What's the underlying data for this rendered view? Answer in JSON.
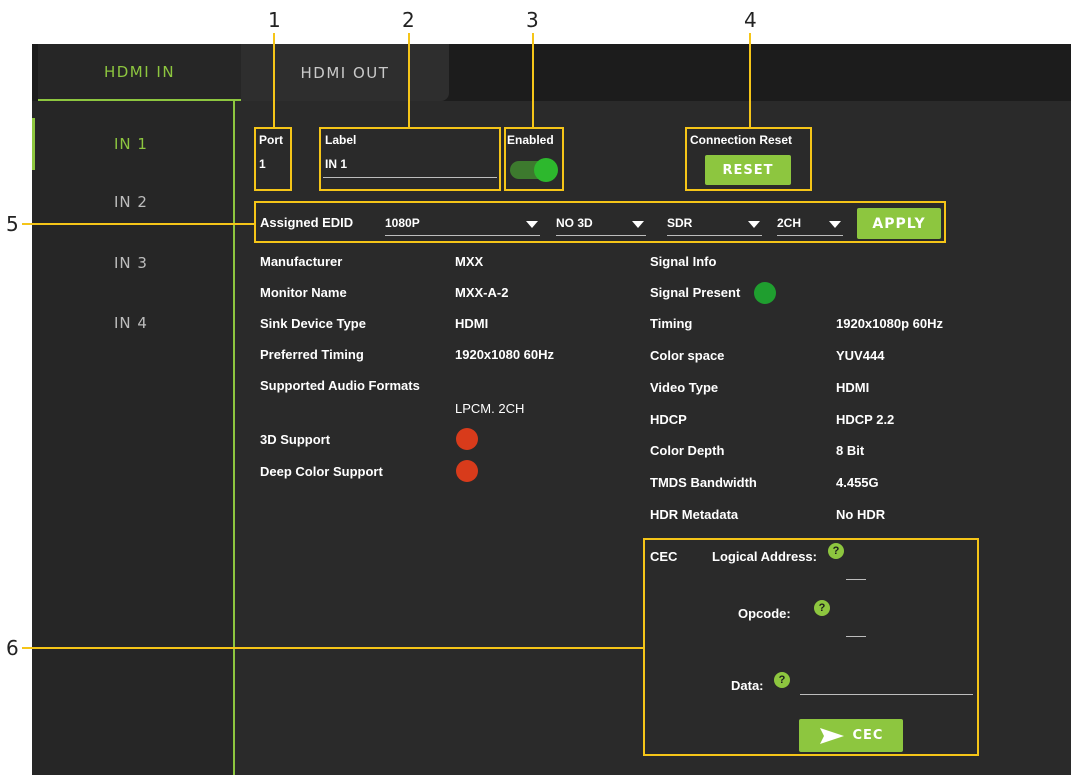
{
  "callouts": [
    "1",
    "2",
    "3",
    "4",
    "5",
    "6"
  ],
  "tabs": {
    "hdmi_in": "HDMI IN",
    "hdmi_out": "HDMI OUT"
  },
  "sidebar": {
    "items": [
      {
        "label": "IN 1"
      },
      {
        "label": "IN 2"
      },
      {
        "label": "IN 3"
      },
      {
        "label": "IN 4"
      }
    ]
  },
  "port": {
    "label": "Port",
    "value": "1"
  },
  "label_field": {
    "label": "Label",
    "value": "IN 1"
  },
  "enabled": {
    "label": "Enabled",
    "state": true
  },
  "connection_reset": {
    "label": "Connection Reset",
    "button": "RESET"
  },
  "edid": {
    "label": "Assigned EDID",
    "resolution": "1080P",
    "three_d": "NO 3D",
    "dynamic_range": "SDR",
    "audio": "2CH",
    "apply": "APPLY"
  },
  "sink_info": {
    "manufacturer_label": "Manufacturer",
    "manufacturer": "MXX",
    "monitor_name_label": "Monitor Name",
    "monitor_name": "MXX-A-2",
    "sink_type_label": "Sink Device Type",
    "sink_type": "HDMI",
    "preferred_timing_label": "Preferred Timing",
    "preferred_timing": "1920x1080 60Hz",
    "audio_formats_label": "Supported Audio Formats",
    "audio_formats": "LPCM. 2CH",
    "three_d_support_label": "3D Support",
    "deep_color_label": "Deep Color Support"
  },
  "signal_info": {
    "title": "Signal Info",
    "present_label": "Signal Present",
    "timing_label": "Timing",
    "timing": "1920x1080p 60Hz",
    "color_space_label": "Color space",
    "color_space": "YUV444",
    "video_type_label": "Video Type",
    "video_type": "HDMI",
    "hdcp_label": "HDCP",
    "hdcp": "HDCP 2.2",
    "color_depth_label": "Color Depth",
    "color_depth": "8 Bit",
    "tmds_label": "TMDS Bandwidth",
    "tmds": "4.455G",
    "hdr_label": "HDR Metadata",
    "hdr": "No HDR"
  },
  "cec": {
    "title": "CEC",
    "logical_address_label": "Logical Address:",
    "opcode_label": "Opcode:",
    "data_label": "Data:",
    "help_glyph": "?",
    "send_button": "CEC"
  },
  "colors": {
    "accent": "#8dc63f",
    "callout": "#f5c518",
    "status_red": "#d83b1b",
    "status_green": "#1f9e2f"
  }
}
